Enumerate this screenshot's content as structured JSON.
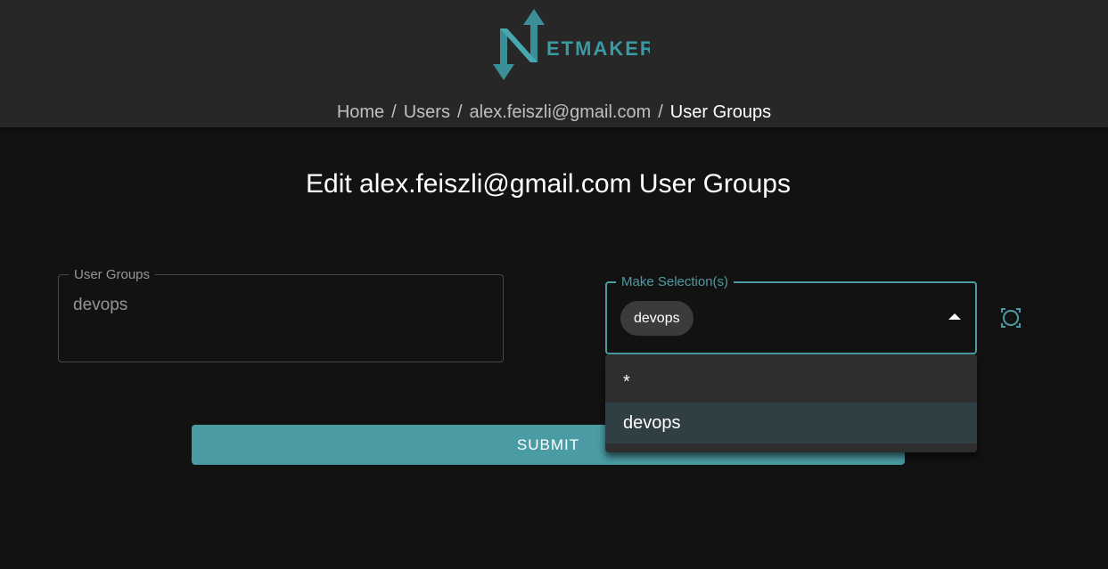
{
  "header": {
    "logo_text": "NETMAKER",
    "breadcrumb": [
      {
        "label": "Home"
      },
      {
        "label": "Users"
      },
      {
        "label": "alex.feiszli@gmail.com"
      },
      {
        "label": "User Groups"
      }
    ],
    "separator": "/"
  },
  "main": {
    "title": "Edit alex.feiszli@gmail.com User Groups",
    "groups_field": {
      "label": "User Groups",
      "value": "devops"
    },
    "selection_field": {
      "label": "Make Selection(s)",
      "chips": [
        "devops"
      ],
      "dropdown_open": true,
      "options": [
        {
          "label": "*",
          "selected": false
        },
        {
          "label": "devops",
          "selected": true
        }
      ]
    },
    "refresh_icon": "refresh-icon",
    "submit_label": "SUBMIT"
  },
  "colors": {
    "accent": "#4a9ba3",
    "header_bg": "#272727",
    "page_bg": "#121212"
  }
}
